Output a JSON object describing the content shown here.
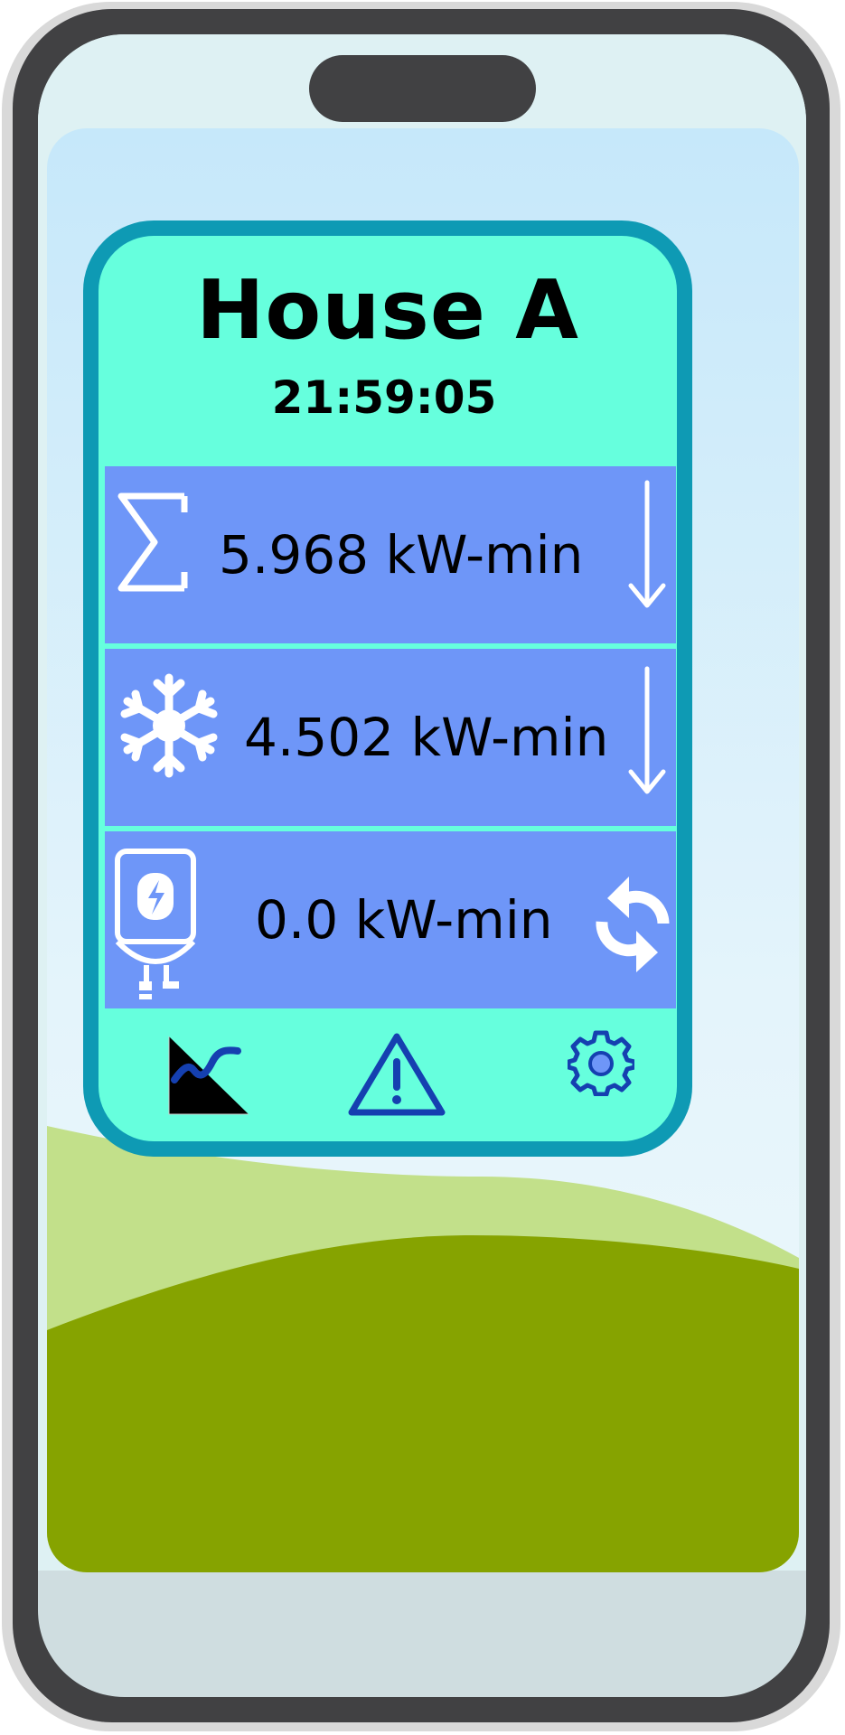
{
  "house": {
    "title": "House A",
    "time": "21:59:05"
  },
  "rows": [
    {
      "icon": "sum-icon",
      "value": "5.968 kW-min",
      "trend_icon": "arrow-down-icon"
    },
    {
      "icon": "snowflake-icon",
      "value": "4.502 kW-min",
      "trend_icon": "arrow-down-icon"
    },
    {
      "icon": "water-heater-icon",
      "value": "0.0 kW-min",
      "trend_icon": "refresh-icon"
    }
  ],
  "nav": [
    {
      "icon": "chart-icon"
    },
    {
      "icon": "warning-icon"
    },
    {
      "icon": "gear-icon"
    }
  ],
  "colors": {
    "card_background": "#66ffdd",
    "card_border": "#0e9ab4",
    "row_background": "#6e96f8",
    "nav_icon": "#1540b0",
    "grass_light": "#c2e08a",
    "grass_dark": "#86a300"
  }
}
